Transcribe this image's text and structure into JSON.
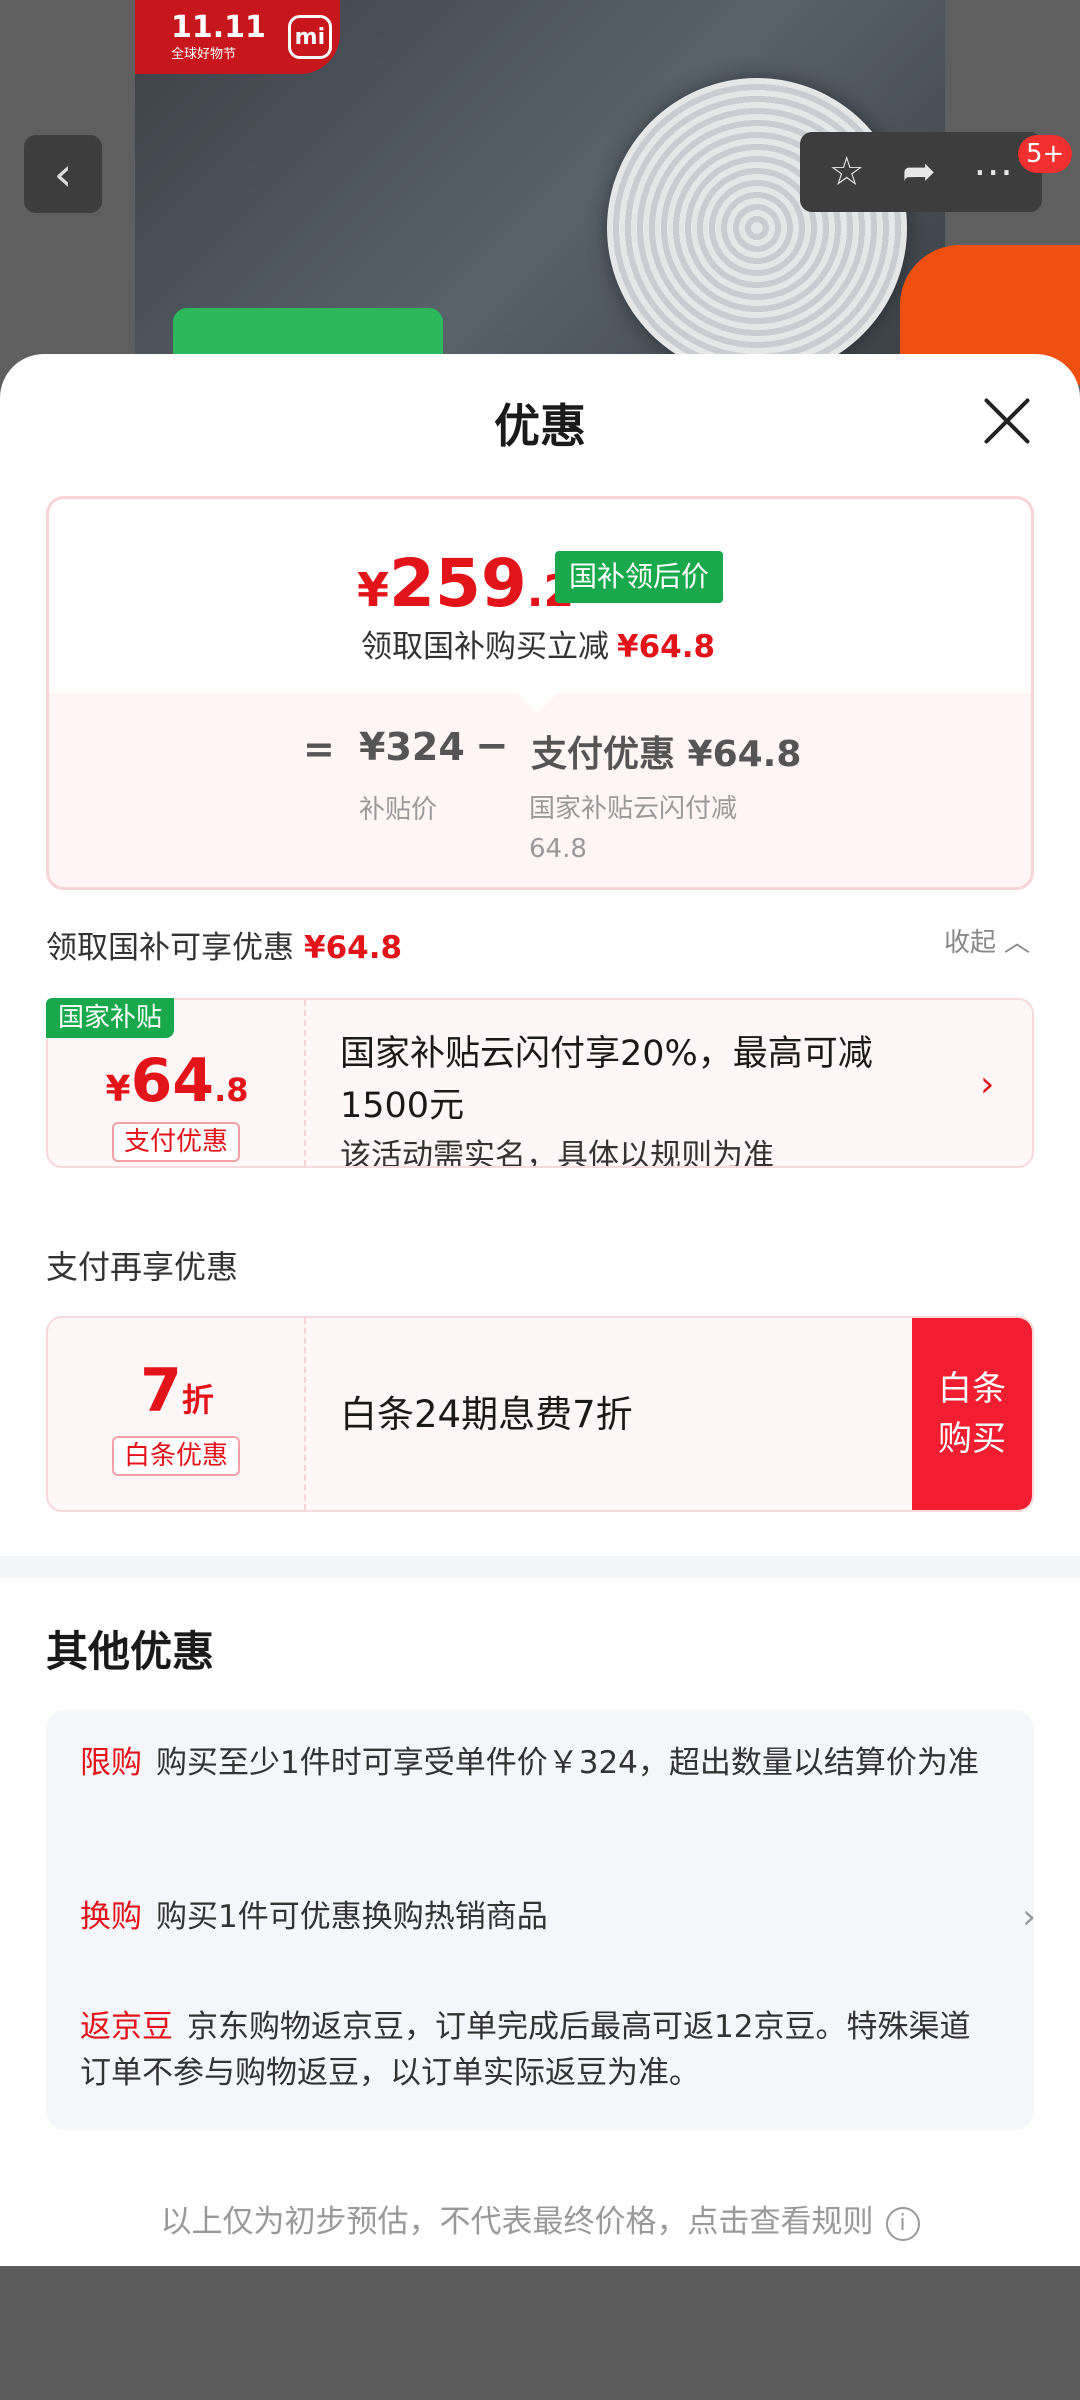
{
  "bg": {
    "badge_text": "11.11",
    "badge_sub": "全球好物节",
    "brand_logo": "mi",
    "notification_count": "5+",
    "icons": [
      "back-icon",
      "star-icon",
      "share-icon",
      "more-icon"
    ]
  },
  "sheet": {
    "title": "优惠",
    "price": {
      "currency": "¥",
      "int": "259",
      "dec": ".2",
      "tag": "国补领后价"
    },
    "claim_text": "领取国补购买立减",
    "claim_amount": "¥64.8",
    "eq": "=",
    "base_price": "¥324",
    "minus": "−",
    "pay_discount": "支付优惠 ¥64.8",
    "label_base": "补贴价",
    "label_pay": "国家补贴云闪付减64.8"
  },
  "enjoy": {
    "text": "领取国补可享优惠",
    "amount": "¥64.8",
    "collapse": "收起"
  },
  "card1": {
    "tag": "国家补贴",
    "currency": "¥",
    "int": "64",
    "dec": ".8",
    "type": "支付优惠",
    "line1": "国家补贴云闪付享20%，最高可减1500元",
    "line2": "该活动需实名，具体以规则为准"
  },
  "pay_again": "支付再享优惠",
  "card2": {
    "int": "7",
    "unit": "折",
    "type": "白条优惠",
    "text": "白条24期息费7折",
    "button": "白条\n购买"
  },
  "other": {
    "title": "其他优惠",
    "rows": [
      {
        "tag": "限购",
        "text": "购买至少1件时可享受单件价￥324，超出数量以结算价为准"
      },
      {
        "tag": "换购",
        "text": "购买1件可优惠换购热销商品"
      },
      {
        "tag": "返京豆",
        "text": "京东购物返京豆，订单完成后最高可返12京豆。特殊渠道订单不参与购物返豆，以订单实际返豆为准。"
      }
    ]
  },
  "footer": "以上仅为初步预估，不代表最终价格，点击查看规则",
  "colors": {
    "accent_red": "#e3131a",
    "green": "#19a84b"
  }
}
